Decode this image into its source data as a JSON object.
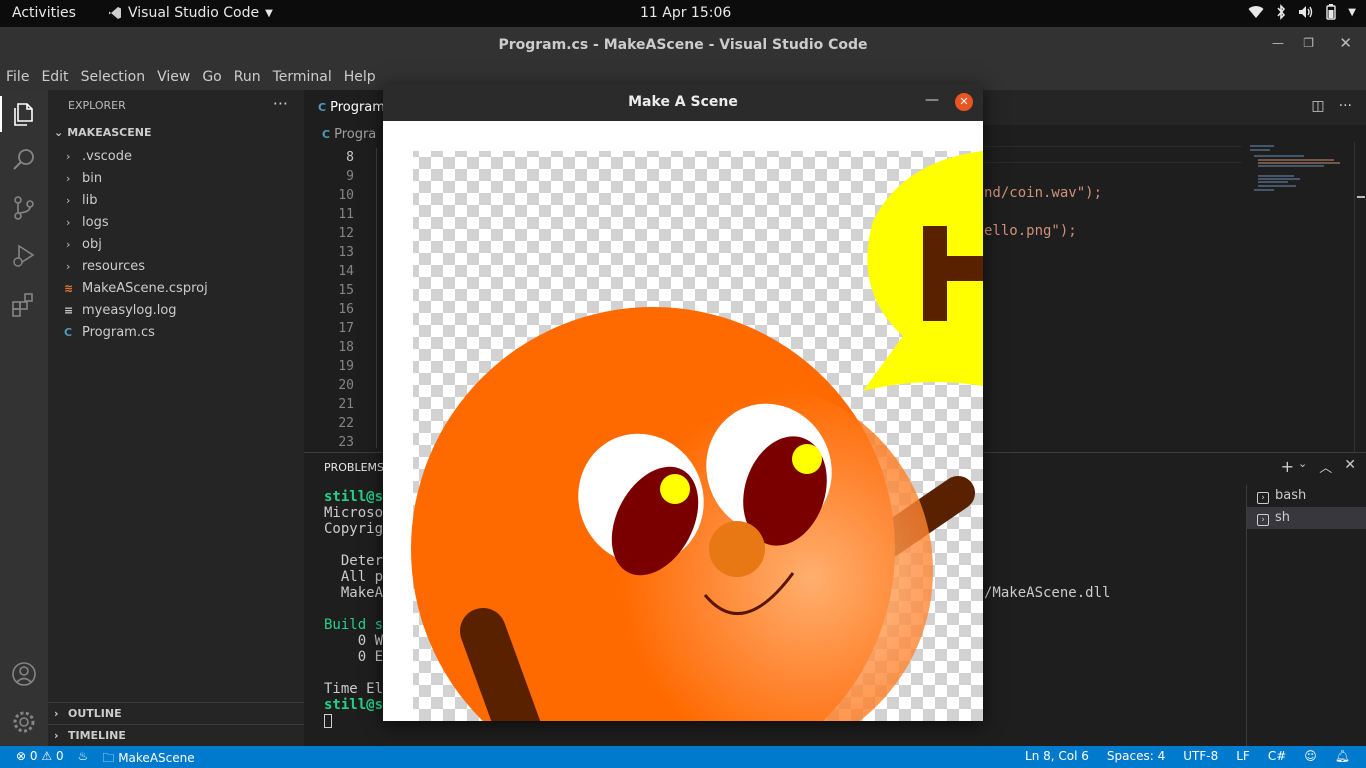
{
  "topbar": {
    "activities": "Activities",
    "app_name": "Visual Studio Code",
    "clock": "11 Apr  15:06"
  },
  "window": {
    "title": "Program.cs - MakeAScene - Visual Studio Code"
  },
  "menu": [
    "File",
    "Edit",
    "Selection",
    "View",
    "Go",
    "Run",
    "Terminal",
    "Help"
  ],
  "explorer": {
    "header": "EXPLORER",
    "project": "MAKEASCENE",
    "items": [
      {
        "label": ".vscode",
        "type": "folder"
      },
      {
        "label": "bin",
        "type": "folder"
      },
      {
        "label": "lib",
        "type": "folder"
      },
      {
        "label": "logs",
        "type": "folder"
      },
      {
        "label": "obj",
        "type": "folder"
      },
      {
        "label": "resources",
        "type": "folder"
      },
      {
        "label": "MakeAScene.csproj",
        "type": "csproj"
      },
      {
        "label": "myeasylog.log",
        "type": "log"
      },
      {
        "label": "Program.cs",
        "type": "cs"
      }
    ],
    "outline": "OUTLINE",
    "timeline": "TIMELINE"
  },
  "editor": {
    "tab": "Program",
    "breadcrumb": "Progra",
    "line_numbers": [
      "8",
      "9",
      "10",
      "11",
      "12",
      "13",
      "14",
      "15",
      "16",
      "17",
      "18",
      "19",
      "20",
      "21",
      "22",
      "23"
    ],
    "code_fragments": [
      "nd/coin.wav\");",
      "ello.png\");"
    ]
  },
  "panel": {
    "tab": "PROBLEMS",
    "terminal_lines": [
      {
        "text": "still@st",
        "style": "green"
      },
      {
        "text": "Microso",
        "style": "plain"
      },
      {
        "text": "Copyrig",
        "style": "plain"
      },
      {
        "text": "  Deter",
        "style": "plain"
      },
      {
        "text": "  All p",
        "style": "plain"
      },
      {
        "text": "  MakeA",
        "style": "plain"
      },
      {
        "text": "Build s",
        "style": "green-plain"
      },
      {
        "text": "    0 W",
        "style": "plain"
      },
      {
        "text": "    0 E",
        "style": "plain"
      },
      {
        "text": "Time El",
        "style": "plain"
      },
      {
        "text": "still@s",
        "style": "green"
      }
    ],
    "right_fragment": "/MakeAScene.dll",
    "terminals": [
      "bash",
      "sh"
    ]
  },
  "statusbar": {
    "errors": "0",
    "warnings": "0",
    "folder": "MakeAScene",
    "position": "Ln 8, Col 6",
    "spaces": "Spaces: 4",
    "encoding": "UTF-8",
    "eol": "LF",
    "language": "C#"
  },
  "popup": {
    "title": "Make A Scene"
  },
  "colors": {
    "accent": "#007acc",
    "character_orange": "#ff6a00",
    "speech_bubble": "#ffff00",
    "arm_brown": "#5a2100",
    "close_button": "#e95420"
  }
}
